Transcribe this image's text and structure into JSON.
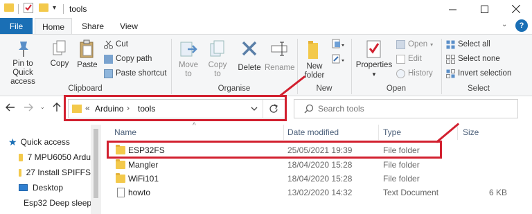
{
  "window": {
    "title": "tools"
  },
  "tabs": [
    "File",
    "Home",
    "Share",
    "View"
  ],
  "ribbon": {
    "clipboard": {
      "pin_label": "Pin to Quick access",
      "copy_label": "Copy",
      "paste_label": "Paste",
      "cut_label": "Cut",
      "copy_path_label": "Copy path",
      "paste_shortcut_label": "Paste shortcut",
      "group_label": "Clipboard"
    },
    "organise": {
      "move_label": "Move to",
      "copy_to_label": "Copy to",
      "delete_label": "Delete",
      "rename_label": "Rename",
      "group_label": "Organise"
    },
    "new": {
      "folder_label": "New folder",
      "group_label": "New"
    },
    "open": {
      "properties_label": "Properties",
      "open_label": "Open",
      "edit_label": "Edit",
      "history_label": "History",
      "group_label": "Open"
    },
    "select": {
      "all_label": "Select all",
      "none_label": "Select none",
      "invert_label": "Invert selection",
      "group_label": "Select"
    }
  },
  "address": {
    "overflow": "«",
    "crumbs": [
      "Arduino",
      "tools"
    ],
    "separator": "›"
  },
  "search": {
    "placeholder": "Search tools"
  },
  "nav_pane": {
    "quick_access": "Quick access",
    "items": [
      "7 MPU6050 Ardu",
      "27 Install SPIFFS",
      "Desktop",
      "Esp32 Deep sleep"
    ]
  },
  "list": {
    "columns": [
      "Name",
      "Date modified",
      "Type",
      "Size"
    ],
    "rows": [
      {
        "name": "ESP32FS",
        "date": "25/05/2021 19:39",
        "type": "File folder",
        "size": "",
        "icon": "folder-icon"
      },
      {
        "name": "Mangler",
        "date": "18/04/2020 15:28",
        "type": "File folder",
        "size": "",
        "icon": "folder-icon"
      },
      {
        "name": "WiFi101",
        "date": "18/04/2020 15:28",
        "type": "File folder",
        "size": "",
        "icon": "folder-icon"
      },
      {
        "name": "howto",
        "date": "13/02/2020 14:32",
        "type": "Text Document",
        "size": "6 KB",
        "icon": "text-document-icon"
      }
    ]
  },
  "colors": {
    "accent": "#1a6fb5",
    "highlight": "#d2202f",
    "folder": "#f3c94b"
  }
}
